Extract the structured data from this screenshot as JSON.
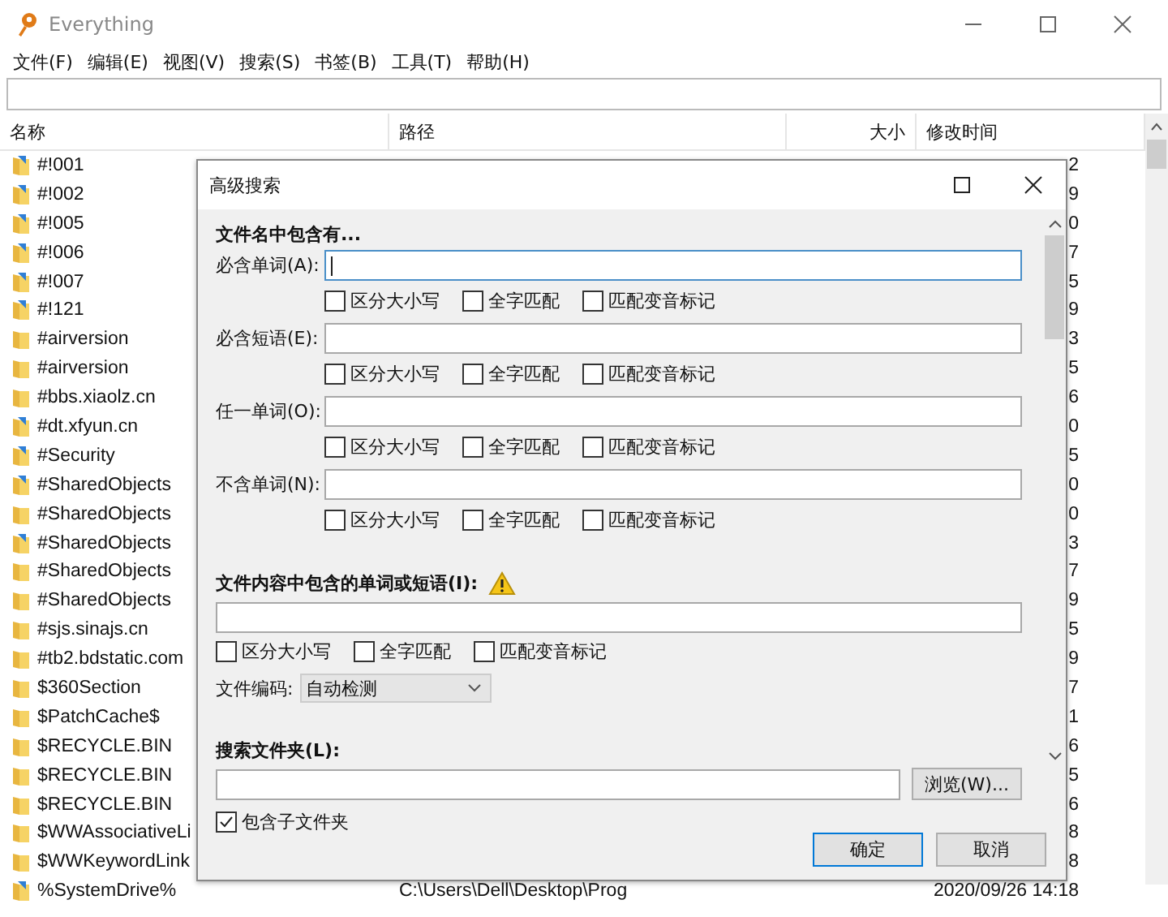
{
  "window": {
    "title": "Everything",
    "menu": [
      "文件(F)",
      "编辑(E)",
      "视图(V)",
      "搜索(S)",
      "书签(B)",
      "工具(T)",
      "帮助(H)"
    ]
  },
  "table": {
    "columns": [
      "名称",
      "路径",
      "大小",
      "修改时间"
    ],
    "rows": [
      {
        "name": "#!001",
        "shortcut": true,
        "date": "2"
      },
      {
        "name": "#!002",
        "shortcut": true,
        "date": "9"
      },
      {
        "name": "#!005",
        "shortcut": true,
        "date": "0"
      },
      {
        "name": "#!006",
        "shortcut": true,
        "date": "7"
      },
      {
        "name": "#!007",
        "shortcut": true,
        "date": "5"
      },
      {
        "name": "#!121",
        "shortcut": true,
        "date": "9"
      },
      {
        "name": "#airversion",
        "shortcut": false,
        "date": "3"
      },
      {
        "name": "#airversion",
        "shortcut": false,
        "date": "5"
      },
      {
        "name": "#bbs.xiaolz.cn",
        "shortcut": false,
        "date": "6"
      },
      {
        "name": "#dt.xfyun.cn",
        "shortcut": true,
        "date": "0"
      },
      {
        "name": "#Security",
        "shortcut": true,
        "date": "5"
      },
      {
        "name": "#SharedObjects",
        "shortcut": true,
        "date": "0"
      },
      {
        "name": "#SharedObjects",
        "shortcut": false,
        "date": "0"
      },
      {
        "name": "#SharedObjects",
        "shortcut": true,
        "date": "3"
      },
      {
        "name": "#SharedObjects",
        "shortcut": false,
        "date": "7"
      },
      {
        "name": "#SharedObjects",
        "shortcut": false,
        "date": "9"
      },
      {
        "name": "#sjs.sinajs.cn",
        "shortcut": false,
        "date": "5"
      },
      {
        "name": "#tb2.bdstatic.com",
        "shortcut": false,
        "date": "9"
      },
      {
        "name": "$360Section",
        "shortcut": false,
        "date": "7"
      },
      {
        "name": "$PatchCache$",
        "shortcut": false,
        "date": "1"
      },
      {
        "name": "$RECYCLE.BIN",
        "shortcut": false,
        "date": "6"
      },
      {
        "name": "$RECYCLE.BIN",
        "shortcut": false,
        "date": "5"
      },
      {
        "name": "$RECYCLE.BIN",
        "shortcut": false,
        "date": "6"
      },
      {
        "name": "$WWAssociativeLi",
        "shortcut": false,
        "date": "8"
      },
      {
        "name": "$WWKeywordLink",
        "shortcut": false,
        "date": "8"
      },
      {
        "name": "%SystemDrive%",
        "shortcut": true,
        "path": "C:\\Users\\Dell\\Desktop\\Prog",
        "date": "2020/09/26 14:18"
      }
    ]
  },
  "dialog": {
    "title": "高级搜索",
    "filename_heading": "文件名中包含有...",
    "fields": [
      {
        "label": "必含单词(A):",
        "focused": true,
        "options": [
          {
            "label": "区分大小写",
            "checked": false
          },
          {
            "label": "全字匹配",
            "checked": false
          },
          {
            "label": "匹配变音标记",
            "checked": false
          }
        ]
      },
      {
        "label": "必含短语(E):",
        "focused": false,
        "options": [
          {
            "label": "区分大小写",
            "checked": false
          },
          {
            "label": "全字匹配",
            "checked": false
          },
          {
            "label": "匹配变音标记",
            "checked": false
          }
        ]
      },
      {
        "label": "任一单词(O):",
        "focused": false,
        "options": [
          {
            "label": "区分大小写",
            "checked": false
          },
          {
            "label": "全字匹配",
            "checked": false
          },
          {
            "label": "匹配变音标记",
            "checked": false
          }
        ]
      },
      {
        "label": "不含单词(N):",
        "focused": false,
        "options": [
          {
            "label": "区分大小写",
            "checked": false
          },
          {
            "label": "全字匹配",
            "checked": false
          },
          {
            "label": "匹配变音标记",
            "checked": false
          }
        ]
      }
    ],
    "content": {
      "heading": "文件内容中包含的单词或短语(I):",
      "options": [
        {
          "label": "区分大小写",
          "checked": false
        },
        {
          "label": "全字匹配",
          "checked": false
        },
        {
          "label": "匹配变音标记",
          "checked": false
        }
      ],
      "encoding_label": "文件编码:",
      "encoding": "自动检测"
    },
    "folder": {
      "heading": "搜索文件夹(L):",
      "browse": "浏览(W)...",
      "subfolders": {
        "label": "包含子文件夹",
        "checked": true
      }
    },
    "buttons": [
      {
        "label": "确定",
        "default": true
      },
      {
        "label": "取消",
        "default": false
      }
    ]
  }
}
